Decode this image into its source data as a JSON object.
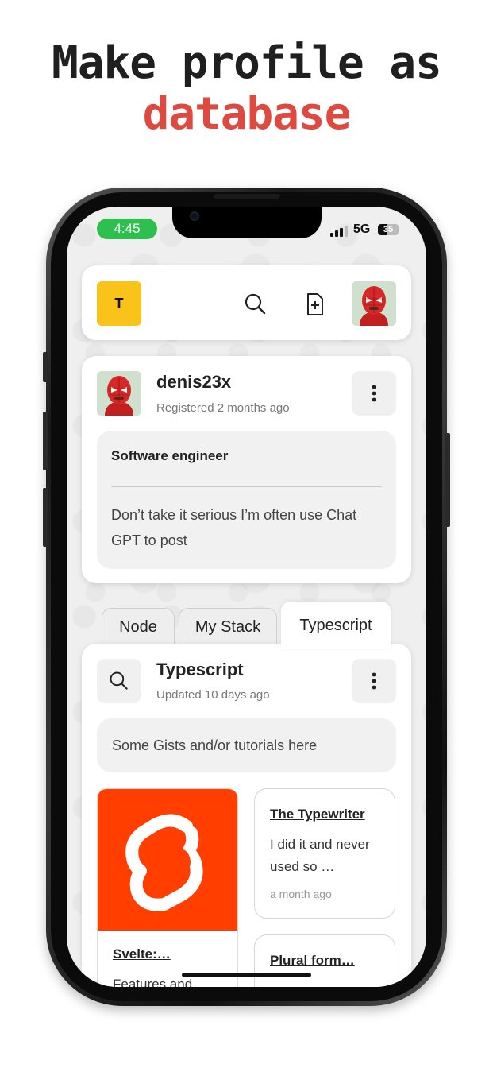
{
  "headline": {
    "line1": "Make profile as",
    "line2": "database"
  },
  "status_bar": {
    "time": "4:45",
    "network": "5G",
    "battery": "35"
  },
  "top_bar": {
    "logo_letter": "T",
    "icons": [
      "search-icon",
      "new-file-icon"
    ]
  },
  "profile": {
    "username": "denis23x",
    "registered": "Registered 2 months ago",
    "bio_title": "Software engineer",
    "bio_text": "Don’t take it serious I’m often use Chat GPT to post"
  },
  "tabs": [
    {
      "label": "Node",
      "active": false
    },
    {
      "label": "My Stack",
      "active": false
    },
    {
      "label": "Typescript",
      "active": true
    }
  ],
  "category": {
    "title": "Typescript",
    "updated": "Updated 10 days ago",
    "description": "Some Gists and/or tutorials here"
  },
  "gists": [
    {
      "title": "Svelte:…",
      "body": "Features and",
      "time": ""
    },
    {
      "title": "The Typewriter",
      "body": "I did it and never used so …",
      "time": "a month ago"
    },
    {
      "title": "Plural form…",
      "body": "",
      "time": ""
    }
  ],
  "colors": {
    "accent": "#de4a3f",
    "logo": "#f9c319",
    "svelte": "#ff3e00",
    "status_green": "#2fbf4e"
  }
}
